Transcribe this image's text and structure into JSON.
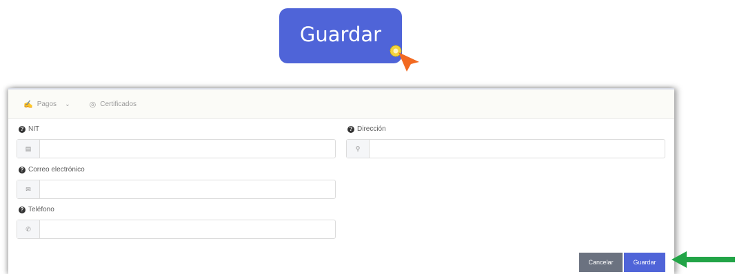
{
  "callout": {
    "label": "Guardar"
  },
  "tabs": [
    {
      "label": "Pagos",
      "icon": "hand-coins-icon",
      "has_dropdown": true
    },
    {
      "label": "Certificados",
      "icon": "certificate-icon",
      "has_dropdown": false
    }
  ],
  "form": {
    "nit": {
      "label": "NIT",
      "value": "",
      "placeholder": ""
    },
    "direccion": {
      "label": "Dirección",
      "value": "",
      "placeholder": ""
    },
    "correo": {
      "label": "Correo electrónico",
      "value": "",
      "placeholder": ""
    },
    "telefono": {
      "label": "Teléfono",
      "value": "",
      "placeholder": ""
    }
  },
  "actions": {
    "cancel_label": "Cancelar",
    "save_label": "Guardar"
  },
  "colors": {
    "primary": "#4f64d8",
    "cancel": "#6b7280",
    "cursor": "#f26a21",
    "arrow": "#22a447"
  }
}
